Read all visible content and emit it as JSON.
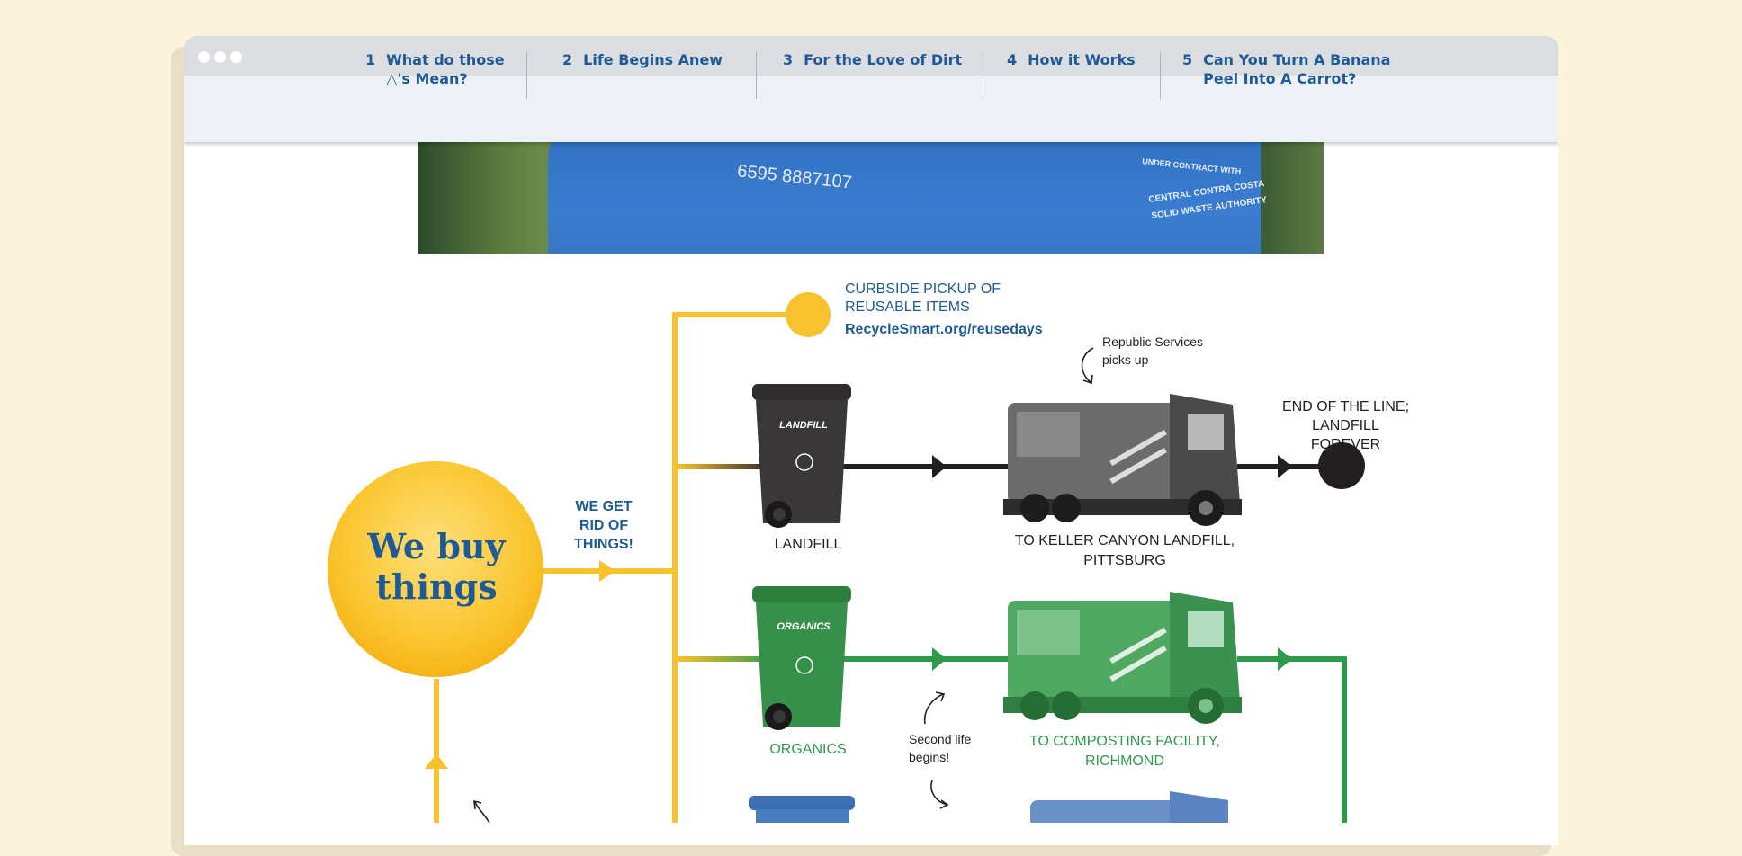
{
  "nav": {
    "items": [
      {
        "num": "1",
        "label": "What do those △'s Mean?"
      },
      {
        "num": "2",
        "label": "Life Begins Anew"
      },
      {
        "num": "3",
        "label": "For the Love of Dirt"
      },
      {
        "num": "4",
        "label": "How it Works"
      },
      {
        "num": "5",
        "label": "Can You Turn A Banana Peel Into A Carrot?"
      }
    ]
  },
  "photo": {
    "bin_number": "6595 8887107",
    "contract_text_1": "UNDER CONTRACT WITH",
    "contract_text_2": "CENTRAL CONTRA COSTA",
    "contract_text_3": "SOLID WASTE AUTHORITY"
  },
  "diagram": {
    "start_circle": "We buy things",
    "get_rid_label": "WE GET RID OF THINGS!",
    "curbside_title": "CURBSIDE PICKUP OF REUSABLE ITEMS",
    "curbside_link": "RecycleSmart.org/reusedays",
    "republic_note": "Republic Services picks up",
    "landfill_bin_label": "LANDFILL",
    "landfill_destination": "TO KELLER CANYON LANDFILL, PITTSBURG",
    "end_of_line": "END OF THE LINE; LANDFILL FOREVER",
    "organics_bin_label": "ORGANICS",
    "organics_destination": "TO COMPOSTING FACILITY, RICHMOND",
    "second_life_note": "Second life begins!",
    "bin_lid_landfill": "LANDFILL",
    "bin_lid_organics": "ORGANICS"
  },
  "colors": {
    "yellow": "#f8c22e",
    "green": "#2f9a4c",
    "black": "#231f20",
    "blue": "#1d5a97",
    "recycle_blue": "#4a7dc0"
  }
}
